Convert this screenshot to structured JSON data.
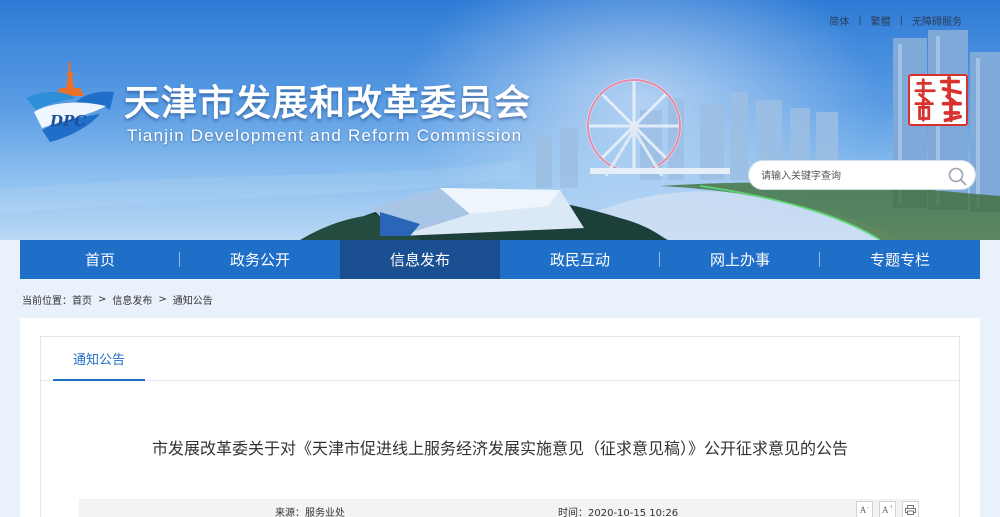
{
  "header": {
    "top_links": [
      "简体",
      "繁體",
      "无障碍服务"
    ],
    "site_title": "天津市发展和改革委员会",
    "site_subtitle": "Tianjin Development and Reform Commission",
    "logo_text": "DPC",
    "seal_text": "天津政务网",
    "search": {
      "placeholder": "请输入关键字查询"
    }
  },
  "nav": {
    "items": [
      "首页",
      "政务公开",
      "信息发布",
      "政民互动",
      "网上办事",
      "专题专栏"
    ],
    "active": "信息发布"
  },
  "breadcrumb": {
    "prefix": "当前位置：",
    "items": [
      "首页",
      "信息发布",
      "通知公告"
    ],
    "separator": ">"
  },
  "content": {
    "tab": "通知公告",
    "title": "市发展改革委关于对《天津市促进线上服务经济发展实施意见（征求意见稿）》公开征求意见的公告",
    "meta": {
      "source": "来源：服务业处",
      "time": "时间：2020-10-15 10:26"
    },
    "tools": [
      "A-",
      "A+",
      "print"
    ]
  },
  "colors": {
    "nav_bg": "#1f6ec7",
    "nav_active": "#1a4f92",
    "accent": "#1f6ec7",
    "seal_red": "#d9312d"
  }
}
